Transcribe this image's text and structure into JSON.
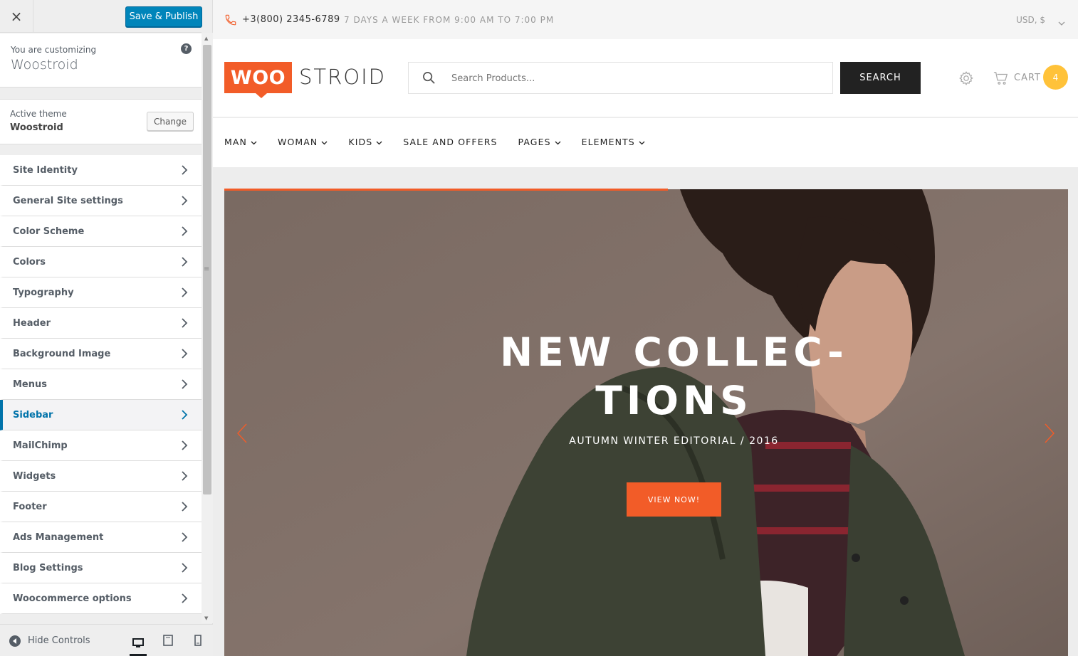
{
  "customizer": {
    "close_label": "×",
    "publish_label": "Save & Publish",
    "customizing_label": "You are customizing",
    "site_name": "Woostroid",
    "help_label": "?",
    "active_theme_label": "Active theme",
    "active_theme_name": "Woostroid",
    "change_label": "Change",
    "sections": [
      {
        "label": "Site Identity"
      },
      {
        "label": "General Site settings"
      },
      {
        "label": "Color Scheme"
      },
      {
        "label": "Colors"
      },
      {
        "label": "Typography"
      },
      {
        "label": "Header"
      },
      {
        "label": "Background Image"
      },
      {
        "label": "Menus"
      },
      {
        "label": "Sidebar",
        "active": true
      },
      {
        "label": "MailChimp"
      },
      {
        "label": "Widgets"
      },
      {
        "label": "Footer"
      },
      {
        "label": "Ads Management"
      },
      {
        "label": "Blog Settings"
      },
      {
        "label": "Woocommerce options"
      }
    ],
    "hide_controls_label": "Hide Controls",
    "devices": [
      "desktop-icon",
      "tablet-icon",
      "mobile-icon"
    ],
    "active_device": "desktop",
    "accent_color": "#0073aa",
    "publish_color": "#0085ba"
  },
  "site": {
    "phone": "+3(800) 2345-6789",
    "hours": "7 DAYS A WEEK FROM 9:00 AM TO 7:00 PM",
    "currency": "USD, $",
    "logo_part1": "WOO",
    "logo_part2": "STROID",
    "search_placeholder": "Search Products...",
    "search_button": "SEARCH",
    "cart_label": "CART",
    "cart_count": "4",
    "nav": [
      {
        "label": "MAN",
        "dropdown": true
      },
      {
        "label": "WOMAN",
        "dropdown": true
      },
      {
        "label": "KIDS",
        "dropdown": true
      },
      {
        "label": "SALE AND OFFERS",
        "dropdown": false
      },
      {
        "label": "PAGES",
        "dropdown": true
      },
      {
        "label": "ELEMENTS",
        "dropdown": true
      }
    ],
    "slide": {
      "title": "NEW COLLEC-\nTIONS",
      "subtitle": "AUTUMN WINTER EDITORIAL / 2016",
      "button": "VIEW NOW!"
    },
    "brand_color": "#f25c28",
    "badge_color": "#ffc239"
  }
}
